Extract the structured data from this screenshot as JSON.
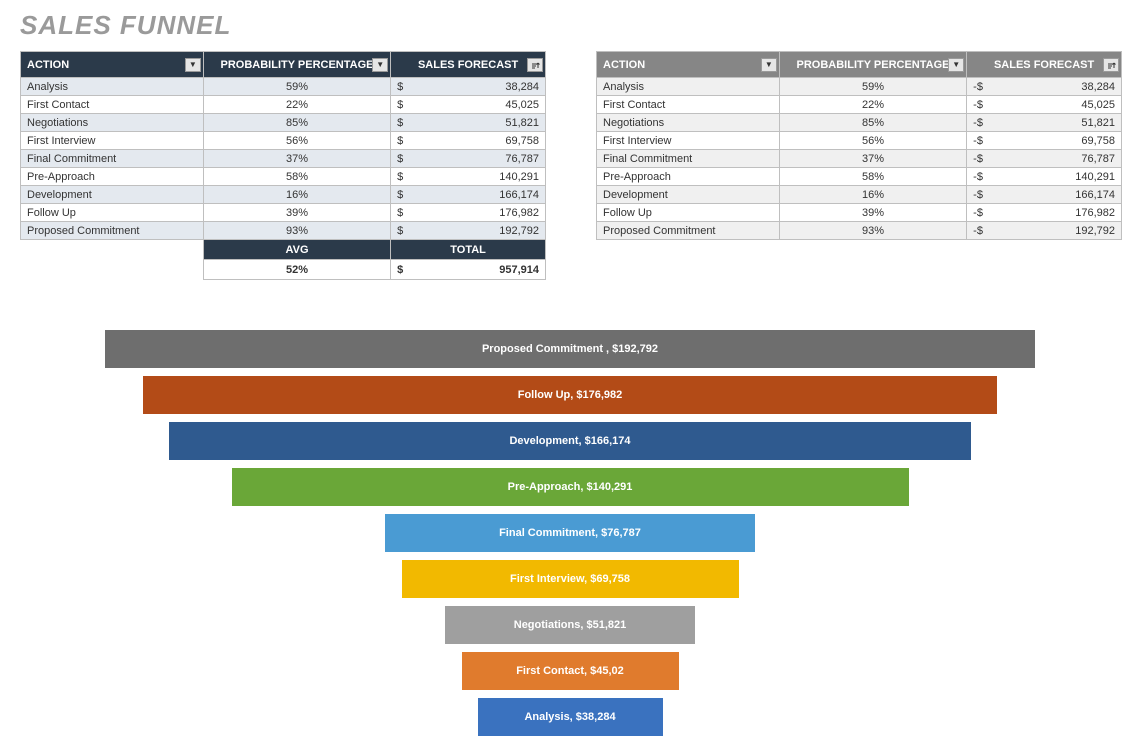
{
  "title": "SALES FUNNEL",
  "headers": {
    "action": "ACTION",
    "prob": "PROBABILITY PERCENTAGE",
    "forecast": "SALES FORECAST"
  },
  "summary": {
    "avg_label": "AVG",
    "total_label": "TOTAL",
    "avg_value": "52%",
    "total_value": "957,914",
    "currency": "$"
  },
  "rows": [
    {
      "action": "Analysis",
      "prob": "59%",
      "forecast": "38,284"
    },
    {
      "action": "First Contact",
      "prob": "22%",
      "forecast": "45,025"
    },
    {
      "action": "Negotiations",
      "prob": "85%",
      "forecast": "51,821"
    },
    {
      "action": "First Interview",
      "prob": "56%",
      "forecast": "69,758"
    },
    {
      "action": "Final Commitment",
      "prob": "37%",
      "forecast": "76,787"
    },
    {
      "action": "Pre-Approach",
      "prob": "58%",
      "forecast": "140,291"
    },
    {
      "action": "Development",
      "prob": "16%",
      "forecast": "166,174"
    },
    {
      "action": "Follow Up",
      "prob": "39%",
      "forecast": "176,982"
    },
    {
      "action": "Proposed Commitment",
      "prob": "93%",
      "forecast": "192,792"
    }
  ],
  "table1_currency": "$",
  "table2_currency": "-$",
  "chart_data": {
    "type": "bar",
    "title": "",
    "orientation": "horizontal-funnel",
    "categories": [
      "Proposed Commitment",
      "Follow Up",
      "Development",
      "Pre-Approach",
      "Final Commitment",
      "First Interview",
      "Negotiations",
      "First Contact",
      "Analysis"
    ],
    "values": [
      192792,
      176982,
      166174,
      140291,
      76787,
      69758,
      51821,
      45025,
      38284
    ],
    "series": [
      {
        "name": "Sales Forecast",
        "values": [
          192792,
          176982,
          166174,
          140291,
          76787,
          69758,
          51821,
          45025,
          38284
        ]
      }
    ],
    "labels": [
      "Proposed Commitment ,  $192,792",
      "Follow Up,  $176,982",
      "Development,  $166,174",
      "Pre-Approach,  $140,291",
      "Final Commitment,  $76,787",
      "First Interview,  $69,758",
      "Negotiations,  $51,821",
      "First Contact,  $45,02",
      "Analysis,  $38,284"
    ],
    "colors": [
      "#6e6e6e",
      "#b34b17",
      "#2f5a8f",
      "#6aa738",
      "#4a9bd3",
      "#f2b900",
      "#9f9f9f",
      "#e07b2d",
      "#3a72bf"
    ],
    "xlim": [
      0,
      192792
    ]
  }
}
